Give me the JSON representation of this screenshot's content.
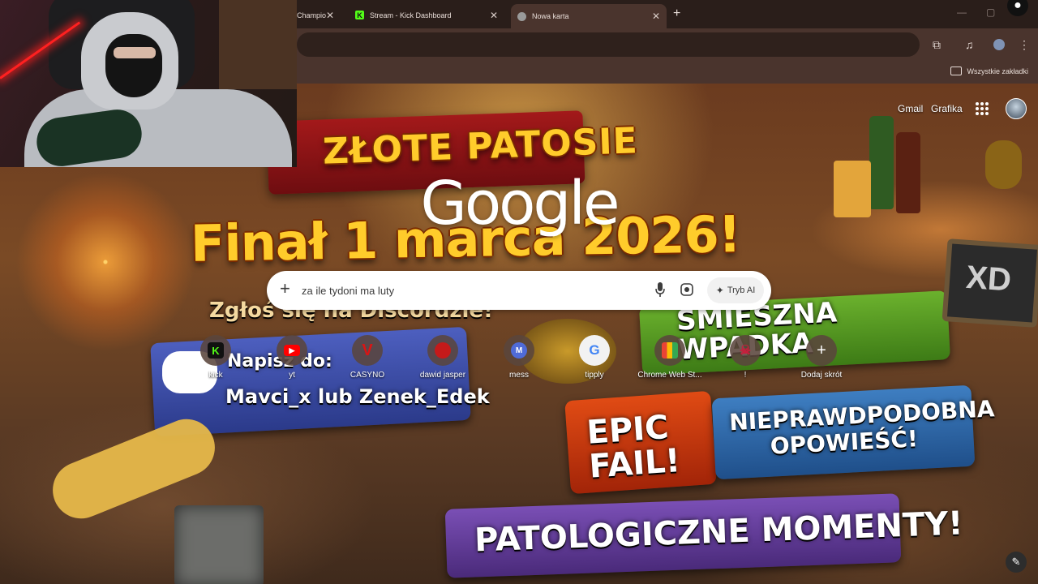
{
  "browser": {
    "tabs": [
      {
        "label": "Champio",
        "active": false,
        "favicon": "champions-icon"
      },
      {
        "label": "Stream - Kick Dashboard",
        "active": false,
        "favicon": "kick-icon"
      },
      {
        "label": "Nowa karta",
        "active": true,
        "favicon": "chrome-icon"
      }
    ],
    "bookmarks_bar": {
      "all_bookmarks": "Wszystkie zakładki"
    }
  },
  "ntp": {
    "header_links": {
      "gmail": "Gmail",
      "images": "Grafika"
    },
    "logo": "Google",
    "search": {
      "query": "za ile tydoni ma luty",
      "ai_mode": "Tryb AI"
    },
    "shortcuts": [
      {
        "label": "kick",
        "icon": "kick-icon",
        "color": "#53fc18"
      },
      {
        "label": "yt",
        "icon": "youtube-icon",
        "color": "#ff0000"
      },
      {
        "label": "CASYNO",
        "icon": "v-logo-icon",
        "color": "#d91515"
      },
      {
        "label": "dawid jasper",
        "icon": "red-circle-icon",
        "color": "#c41a1a"
      },
      {
        "label": "mess",
        "icon": "letter-m-icon",
        "color": "#4f6bd8"
      },
      {
        "label": "tipply",
        "icon": "google-g-icon",
        "color": "#4285f4"
      },
      {
        "label": "Chrome Web St...",
        "icon": "chrome-web-store-icon",
        "color": "#f2f2f2"
      },
      {
        "label": "!",
        "icon": "skull-icon",
        "color": "#c81e3c"
      },
      {
        "label": "Dodaj skrót",
        "icon": "plus-icon",
        "color": "#ffffff"
      }
    ]
  },
  "wallpaper": {
    "title_top": "ZŁOTE PATOSIE",
    "title_main": "Finał 1 marca 2026!",
    "discord_cta": "Zgłoś się na Discordzie!",
    "discord_write": "Napisz do:",
    "discord_names": "Mavci_x lub Zenek_Edek",
    "funny_fail": "ŚMIESZNA WPADKA",
    "epic_fail": "EPIC FAIL!",
    "unbelievable_story": "NIEPRAWDPODOBNA OPOWIEŚĆ!",
    "patho_moments": "PATOLOGICZNE MOMENTY!",
    "xd": "XD"
  }
}
